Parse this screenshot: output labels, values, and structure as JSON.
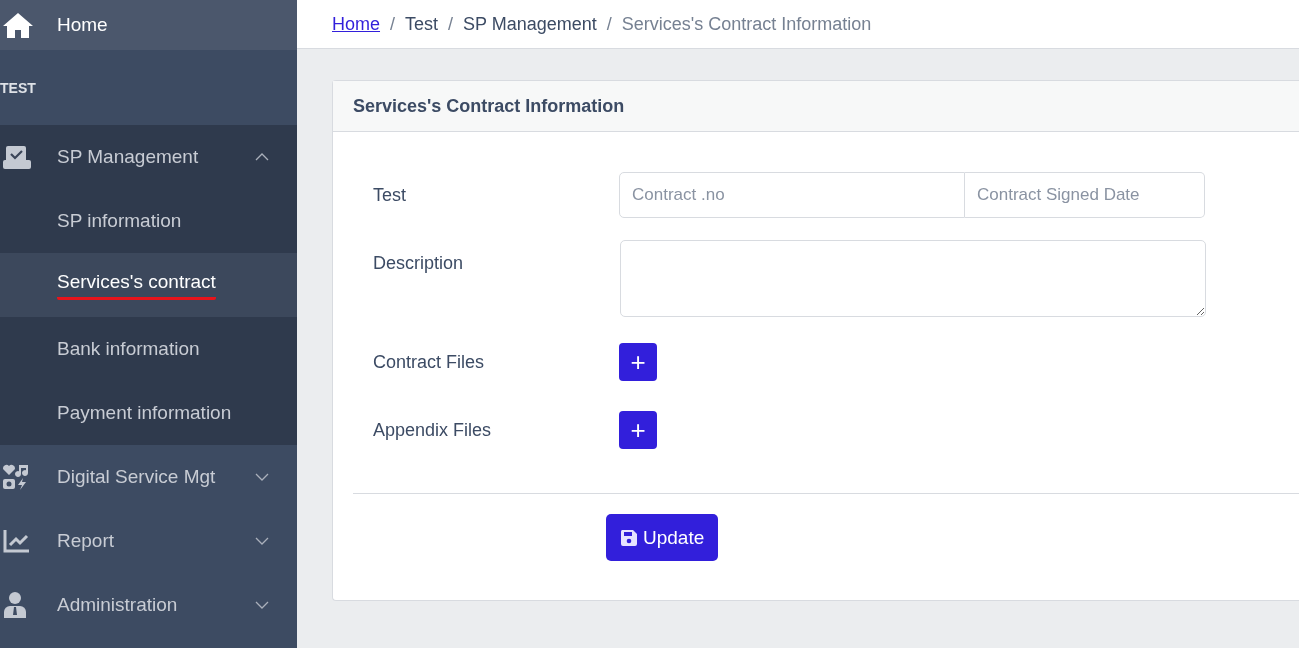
{
  "sidebar": {
    "home": {
      "label": "Home"
    },
    "section_label": "TEST",
    "items": [
      {
        "label": "SP Management",
        "expanded": true,
        "children": [
          {
            "label": "SP information",
            "selected": false,
            "underlined": false
          },
          {
            "label": "Services's contract",
            "selected": true,
            "underlined": true
          },
          {
            "label": "Bank information",
            "selected": false,
            "underlined": false
          },
          {
            "label": "Payment information",
            "selected": false,
            "underlined": false
          }
        ]
      },
      {
        "label": "Digital Service Mgt",
        "expanded": false
      },
      {
        "label": "Report",
        "expanded": false
      },
      {
        "label": "Administration",
        "expanded": false
      }
    ]
  },
  "breadcrumb": [
    {
      "label": "Home",
      "kind": "link"
    },
    {
      "separator": "/",
      "label": "Test",
      "kind": "crumb"
    },
    {
      "separator": "/",
      "label": "SP Management",
      "kind": "crumb"
    },
    {
      "separator": "/",
      "label": "Services's Contract Information",
      "kind": "current"
    }
  ],
  "card": {
    "title": "Services's Contract Information",
    "fields": [
      {
        "label": "Test",
        "kind": "pair",
        "placeholders": [
          "Contract .no",
          "Contract Signed Date"
        ]
      },
      {
        "label": "Description",
        "kind": "textarea"
      },
      {
        "label": "Contract Files",
        "kind": "add",
        "button": "+"
      },
      {
        "label": "Appendix Files",
        "kind": "add",
        "button": "+"
      }
    ],
    "submit": {
      "label": "Update"
    }
  }
}
